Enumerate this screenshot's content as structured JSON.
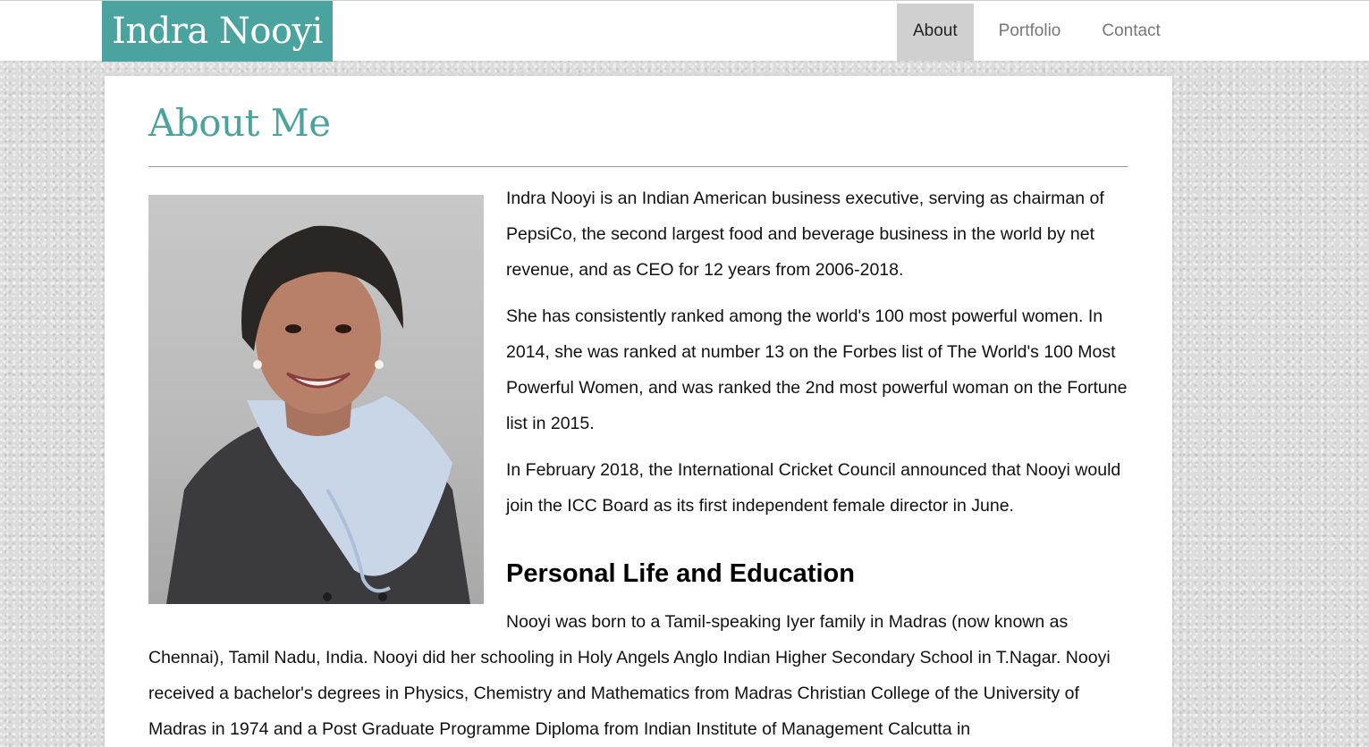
{
  "header": {
    "brand": "Indra Nooyi",
    "nav": [
      "About",
      "Portfolio",
      "Contact"
    ],
    "active_nav": "About"
  },
  "main": {
    "title": "About Me",
    "paragraphs": [
      "Indra Nooyi is an Indian American business executive, serving as chairman of PepsiCo, the second largest food and beverage business in the world by net revenue, and as CEO for 12 years from 2006-2018.",
      "She has consistently ranked among the world's 100 most powerful women. In 2014, she was ranked at number 13 on the Forbes list of The World's 100 Most Powerful Women, and was ranked the 2nd most powerful woman on the Fortune list in 2015.",
      "In February 2018, the International Cricket Council announced that Nooyi would join the ICC Board as its first independent female director in June."
    ],
    "section_heading": "Personal Life and Education",
    "section_paragraph": "Nooyi was born to a Tamil-speaking Iyer family in Madras (now known as Chennai), Tamil Nadu, India. Nooyi did her schooling in Holy Angels Anglo Indian Higher Secondary School in T.Nagar. Nooyi received a bachelor's degrees in Physics, Chemistry and Mathematics from Madras Christian College of the University of Madras in 1974 and a Post Graduate Programme Diploma from Indian Institute of Management Calcutta in"
  },
  "colors": {
    "accent": "#4aa39e",
    "nav_active_bg": "#d0d0d0",
    "page_background": "#dcdcdc"
  }
}
